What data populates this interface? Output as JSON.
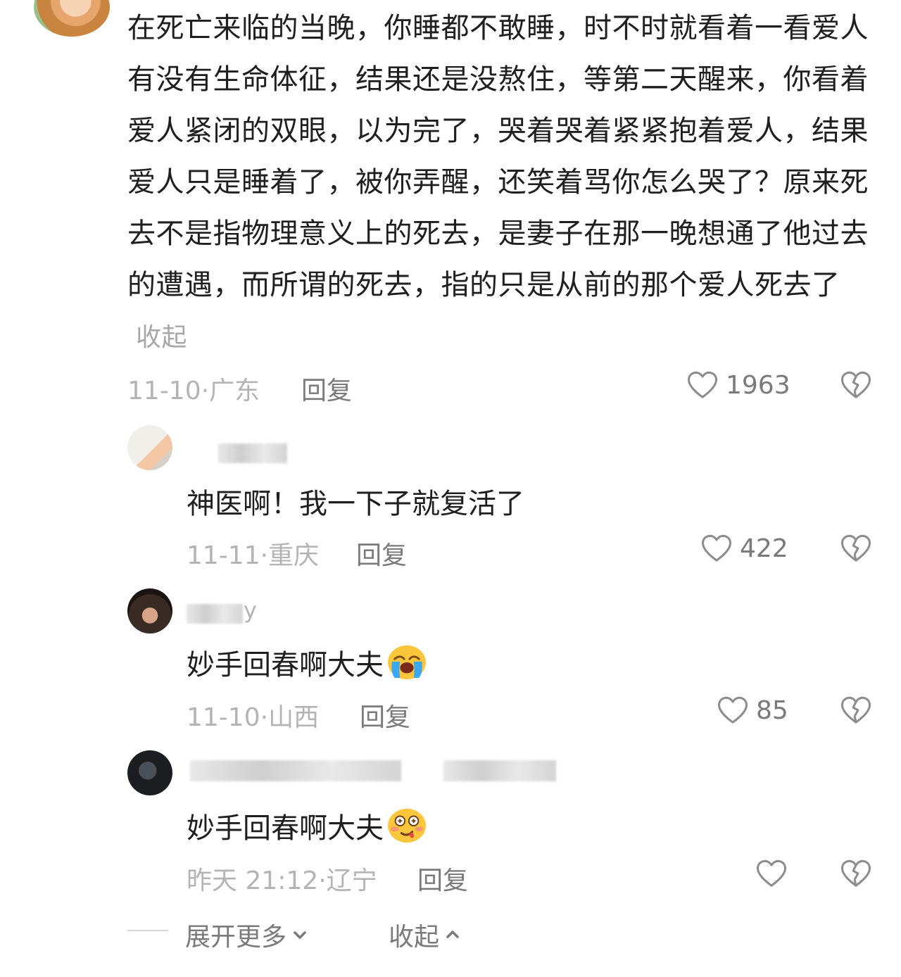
{
  "main_comment": {
    "text": "在死亡来临的当晚，你睡都不敢睡，时不时就看着一看爱人有没有生命体征，结果还是没熬住，等第二天醒来，你看着爱人紧闭的双眼，以为完了，哭着哭着紧紧抱着爱人，结果爱人只是睡着了，被你弄醒，还笑着骂你怎么哭了？原来死去不是指物理意义上的死去，是妻子在那一晚想通了他过去的遭遇，而所谓的死去，指的只是从前的那个爱人死去了",
    "collapse_label": "收起",
    "date": "11-10",
    "location": "广东",
    "reply_label": "回复",
    "likes": "1963"
  },
  "replies": [
    {
      "text": "神医啊！我一下子就复活了",
      "date": "11-11",
      "location": "重庆",
      "reply_label": "回复",
      "likes": "422",
      "emoji": ""
    },
    {
      "username": "y",
      "text": "妙手回春啊大夫",
      "date": "11-10",
      "location": "山西",
      "reply_label": "回复",
      "likes": "85",
      "emoji": "loudly-crying-face"
    },
    {
      "text": "妙手回春啊大夫",
      "date": "昨天 21:12",
      "location": "辽宁",
      "reply_label": "回复",
      "likes": "",
      "emoji": "woozy-face"
    }
  ],
  "footer": {
    "expand_label": "展开更多",
    "collapse_label": "收起"
  },
  "separator": "·"
}
